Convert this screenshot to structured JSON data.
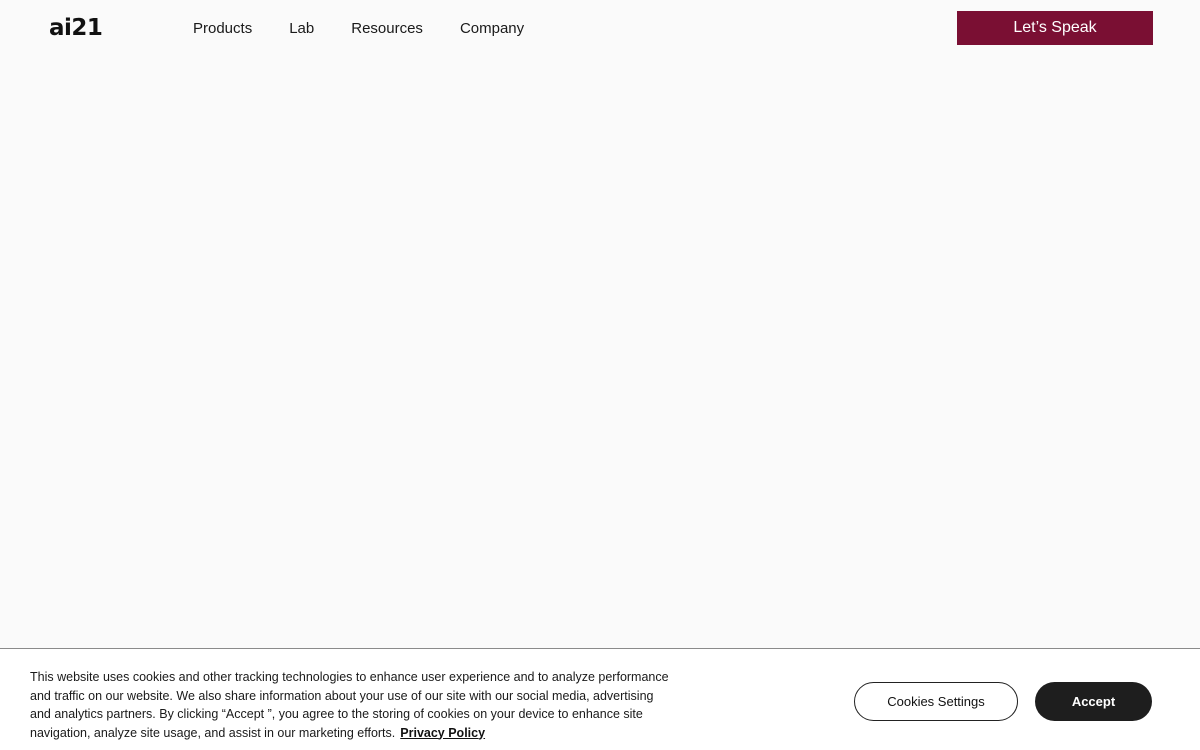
{
  "header": {
    "logo_text": "ai21",
    "nav": [
      {
        "label": "Products"
      },
      {
        "label": "Lab"
      },
      {
        "label": "Resources"
      },
      {
        "label": "Company"
      }
    ],
    "cta_label": "Let’s Speak"
  },
  "cookie_banner": {
    "text": "This website uses cookies and other tracking technologies to enhance user experience and to analyze performance and traffic on our website. We also share information about your use of our site with our social media, advertising and analytics partners. By clicking “Accept ”, you agree to the storing of cookies on your device to enhance site navigation, analyze site usage, and assist in our marketing efforts.",
    "privacy_link": "Privacy Policy",
    "settings_label": "Cookies Settings",
    "accept_label": "Accept"
  },
  "colors": {
    "background": "#fafafa",
    "cta": "#7a0f33",
    "accept": "#1e1e1e"
  }
}
